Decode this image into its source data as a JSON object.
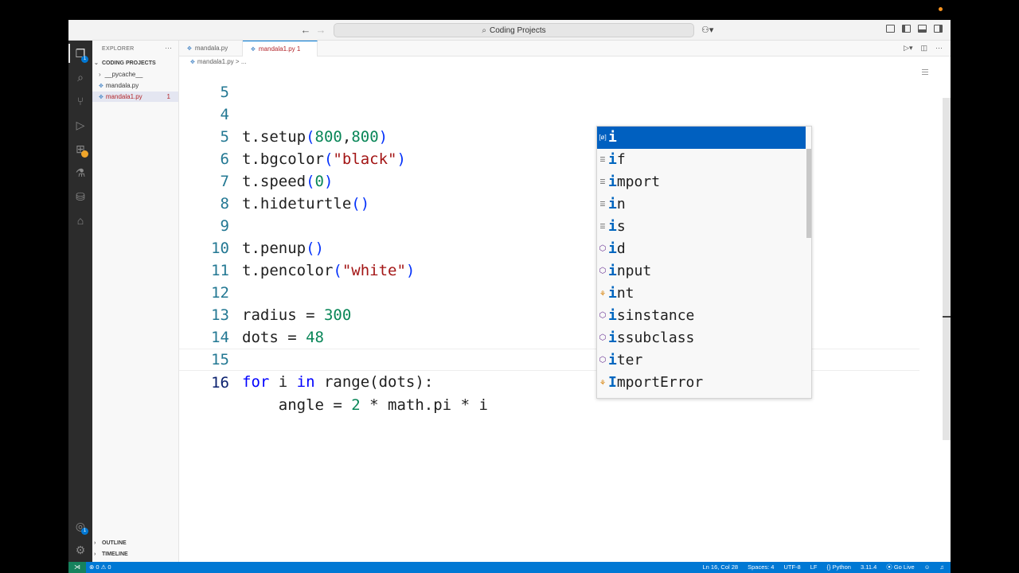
{
  "titlebar": {
    "search_text": "Coding Projects"
  },
  "sidebar": {
    "title": "EXPLORER",
    "dots": "···",
    "folder": "CODING PROJECTS",
    "items": [
      {
        "label": "__pycache__"
      },
      {
        "label": "mandala.py"
      },
      {
        "label": "mandala1.py",
        "problems": "1"
      }
    ],
    "outline": "OUTLINE",
    "timeline": "TIMELINE"
  },
  "tabs": [
    {
      "label": "mandala.py"
    },
    {
      "label": "mandala1.py",
      "problems": "1"
    }
  ],
  "breadcrumb": {
    "file": "mandala1.py",
    "sep": "> ..."
  },
  "editor": {
    "lines": [
      {
        "n": "5"
      },
      {
        "n": "4"
      },
      {
        "n": "5"
      },
      {
        "n": "6"
      },
      {
        "n": "7"
      },
      {
        "n": "8"
      },
      {
        "n": "9"
      },
      {
        "n": "10"
      },
      {
        "n": "11"
      },
      {
        "n": "12"
      },
      {
        "n": "13"
      },
      {
        "n": "14"
      },
      {
        "n": "15"
      },
      {
        "n": "16"
      }
    ]
  },
  "suggest": {
    "items": [
      {
        "hl": "i",
        "rest": "",
        "kind": "variable"
      },
      {
        "hl": "i",
        "rest": "f",
        "kind": "keyword"
      },
      {
        "hl": "i",
        "rest": "mport",
        "kind": "keyword"
      },
      {
        "hl": "i",
        "rest": "n",
        "kind": "keyword"
      },
      {
        "hl": "i",
        "rest": "s",
        "kind": "keyword"
      },
      {
        "hl": "i",
        "rest": "d",
        "kind": "function"
      },
      {
        "hl": "i",
        "rest": "nput",
        "kind": "function"
      },
      {
        "hl": "i",
        "rest": "nt",
        "kind": "class"
      },
      {
        "hl": "i",
        "rest": "sinstance",
        "kind": "function"
      },
      {
        "hl": "i",
        "rest": "ssubclass",
        "kind": "function"
      },
      {
        "hl": "i",
        "rest": "ter",
        "kind": "function"
      },
      {
        "hl": "I",
        "rest": "mportError",
        "kind": "class"
      }
    ]
  },
  "statusbar": {
    "problems": "⊗ 0 ⚠ 0",
    "position": "Ln 16, Col 28",
    "spaces": "Spaces: 4",
    "encoding": "UTF-8",
    "eol": "LF",
    "language": "Python",
    "version": "3.11.4",
    "golive": "Go Live"
  },
  "activity": {
    "scm_badge": "1",
    "account_badge": "1"
  }
}
